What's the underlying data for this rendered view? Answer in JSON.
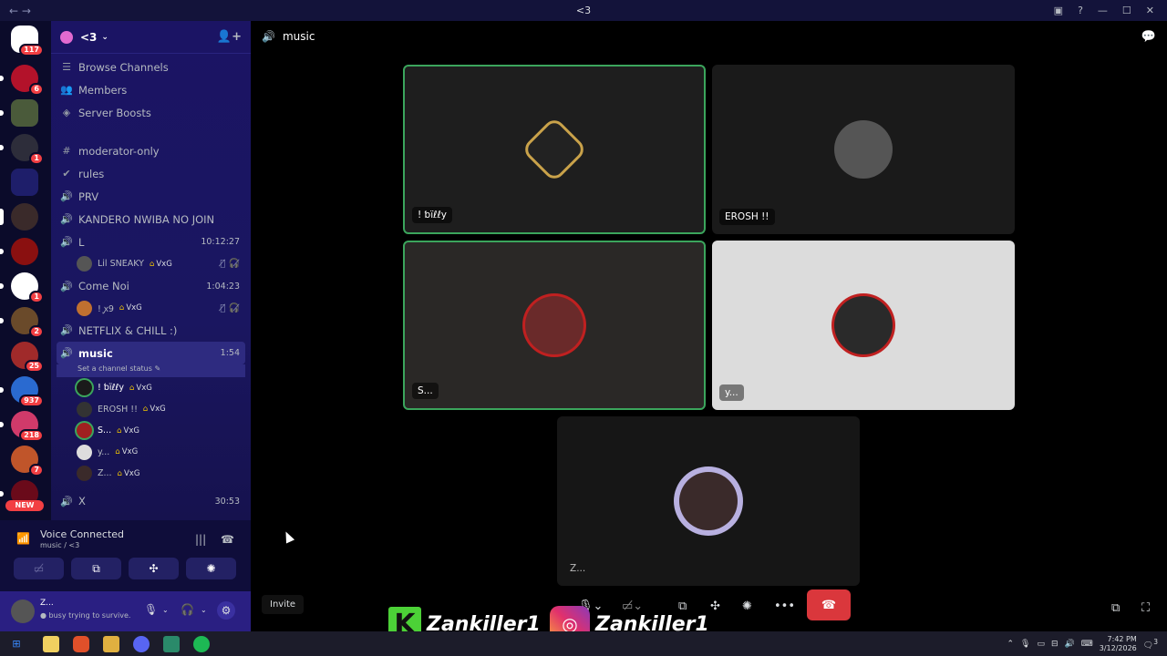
{
  "window": {
    "title": "<3",
    "back": "←",
    "forward": "→"
  },
  "server_badges": {
    "top": "117",
    "s1": "6",
    "s2": "1",
    "s3": "1",
    "s4": "2",
    "s5": "25",
    "s6": "937",
    "s7": "218",
    "s8": "7",
    "new": "NEW"
  },
  "server": {
    "name": "<3"
  },
  "nav": [
    {
      "label": "Browse Channels",
      "icon": "☰"
    },
    {
      "label": "Members",
      "icon": "👥"
    },
    {
      "label": "Server Boosts",
      "icon": "◈"
    }
  ],
  "channels": [
    {
      "name": "moderator-only",
      "icon": "#"
    },
    {
      "name": "rules",
      "icon": "✔"
    },
    {
      "name": "PRV",
      "icon": "🔊"
    },
    {
      "name": "KANDERO NWIBA NO JOIN",
      "icon": "🔊"
    }
  ],
  "voice_L": {
    "name": "L",
    "time": "10:12:27",
    "member": "Lil SNEAKY",
    "tag": "VxG"
  },
  "voice_cn": {
    "name": "Come Noi",
    "time": "1:04:23",
    "member": "! ꭙ9",
    "tag": "VxG"
  },
  "voice_nf": {
    "name": "NETFLIX & CHILL :)"
  },
  "voice_music": {
    "name": "music",
    "time": "1:54",
    "status": "Set a channel status",
    "members": [
      {
        "name": "! ƅïℓℓy",
        "tag": "VxG"
      },
      {
        "name": "EROSH !!",
        "tag": "VxG"
      },
      {
        "name": "S...",
        "tag": "VxG"
      },
      {
        "name": "y...",
        "tag": "VxG"
      },
      {
        "name": "Z...",
        "tag": "VxG"
      }
    ]
  },
  "voice_x": {
    "name": "X",
    "time": "30:53"
  },
  "voice_panel": {
    "title": "Voice Connected",
    "sub": "music / <3"
  },
  "user": {
    "name": "Z...",
    "status": "busy trying to survive."
  },
  "main": {
    "channel": "music"
  },
  "tiles": [
    {
      "label": "! ƅïℓℓy"
    },
    {
      "label": "EROSH !!"
    },
    {
      "label": "S..."
    },
    {
      "label": "y..."
    },
    {
      "label": "Z..."
    }
  ],
  "invite": "Invite",
  "social": {
    "kick": "Zankiller1",
    "instagram": "Zankiller1"
  },
  "clock": {
    "time": "7:42 PM",
    "date": "3/12/2026"
  },
  "notif_count": "3",
  "colors": {
    "sidebar": "#1b1464",
    "speaking": "#3ba55c",
    "end_call": "#da373c",
    "badge": "#f23f43"
  }
}
